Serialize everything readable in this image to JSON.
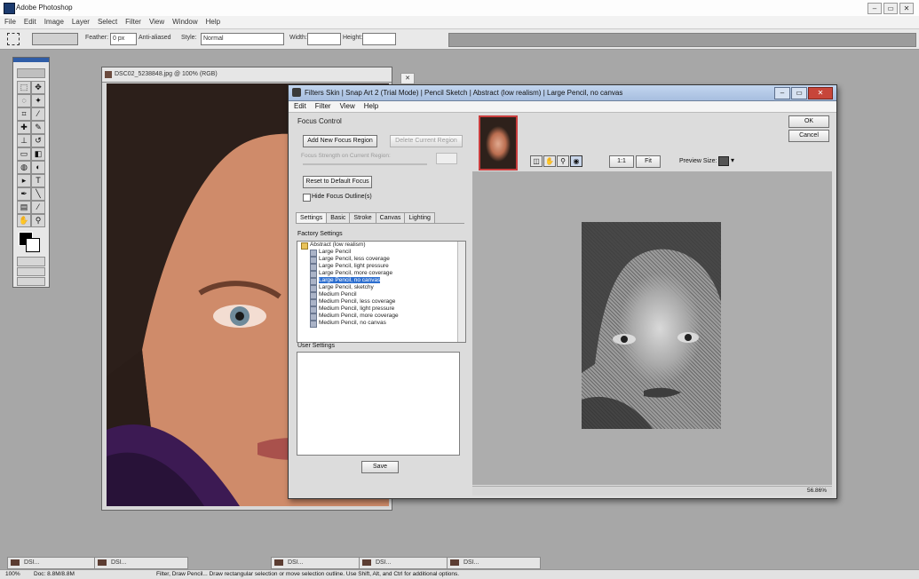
{
  "app": {
    "title": "Adobe Photoshop",
    "window_buttons": [
      "–",
      "▭",
      "✕"
    ],
    "menu": [
      "File",
      "Edit",
      "Image",
      "Layer",
      "Select",
      "Filter",
      "View",
      "Window",
      "Help"
    ]
  },
  "options": {
    "feather_label": "Feather:",
    "feather_value": "0 px",
    "antialiased_label": "Anti-aliased",
    "style_label": "Style:",
    "style_value": "Normal",
    "width_label": "Width:",
    "height_label": "Height:"
  },
  "document": {
    "title": "DSC02_5238848.jpg @ 100% (RGB)",
    "window_buttons": [
      "–",
      "▭",
      "✕"
    ]
  },
  "dialog": {
    "title": "Filters Skin | Snap Art 2 (Trial Mode) | Pencil Sketch | Abstract (low realism) | Large Pencil, no canvas",
    "menu": [
      "Edit",
      "Filter",
      "View",
      "Help"
    ],
    "focus_control_label": "Focus Control",
    "add_focus_region": "Add New Focus Region",
    "delete_focus_region": "Delete Current Region",
    "focus_strength_label": "Focus Strength on Current Region:",
    "reset_focus": "Reset to Default Focus",
    "hide_focus_outline": "Hide Focus Outline(s)",
    "tabs": [
      "Settings",
      "Basic",
      "Stroke",
      "Canvas",
      "Lighting"
    ],
    "factory_settings_label": "Factory Settings",
    "tree": {
      "root": "Abstract (low realism)",
      "items": [
        "Large Pencil",
        "Large Pencil, less coverage",
        "Large Pencil, light pressure",
        "Large Pencil, more coverage",
        "Large Pencil, no canvas",
        "Large Pencil, sketchy",
        "Medium Pencil",
        "Medium Pencil, less coverage",
        "Medium Pencil, light pressure",
        "Medium Pencil, more coverage",
        "Medium Pencil, no canvas"
      ],
      "selected_index": 4
    },
    "user_settings_label": "User Settings",
    "save": "Save",
    "ok": "OK",
    "cancel": "Cancel",
    "zoom_buttons": [
      "1:1",
      "Fit"
    ],
    "preview_size_label": "Preview Size:",
    "zoom_percent": "56.86%"
  },
  "taskbar": {
    "minimized": [
      "DSI...",
      "DSI...",
      "DSI...",
      "DSI...",
      "DSI..."
    ],
    "status_left": "100%",
    "status_doc": "Doc: 8.8M/8.8M",
    "status_hint": "Filter, Draw Pencil... Draw rectangular selection or move selection outline. Use Shift, Alt, and Ctrl for additional options."
  },
  "colors": {
    "workspace": "#a7a7a7",
    "dialog_title": "#a7bedf",
    "selection": "#2e6fcf",
    "close_button": "#c7453a"
  }
}
